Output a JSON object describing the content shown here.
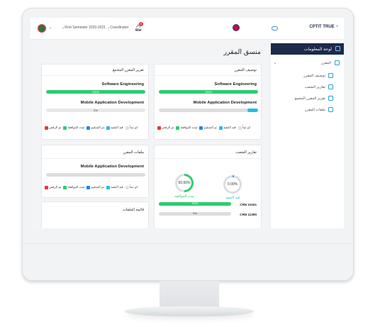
{
  "topbar": {
    "semester": "First Semester 2020-2021",
    "role": "Coordinator",
    "notifications": "0",
    "brand": "CPTIT TRUE"
  },
  "sidebar": {
    "dashboard": "لوحة المعلومات",
    "course": "المقرر",
    "items": [
      "توصيف المقرر",
      "تقارير الشعب",
      "تقرير المقرر المجمع",
      "ملفات المقرر"
    ]
  },
  "main": {
    "title": "منسق المقرر",
    "course_spec": {
      "header": "توصيف المقرر",
      "courses": [
        {
          "name": "Software Engineering",
          "percent": "100%",
          "progress": 100,
          "color": "#2ecc71"
        },
        {
          "name": "Mobile Application Development",
          "percent": "",
          "progress": 11,
          "color": "#1bbfe6"
        }
      ]
    },
    "combined_report": {
      "header": "تقرير المقرر المجمع",
      "courses": [
        {
          "name": "Software Engineering",
          "percent": "100%",
          "progress": 100,
          "color": "#2ecc71"
        },
        {
          "name": "Mobile Application Development",
          "percent": "0%",
          "progress": 0,
          "color": "#2ecc71"
        }
      ]
    },
    "legend": [
      {
        "label": "لم تبدأ",
        "color": "#e0e0e0"
      },
      {
        "label": "قيد التنفيذ",
        "color": "#29b6f6"
      },
      {
        "label": "تم التسليم",
        "color": "#1e88e5"
      },
      {
        "label": "تمت الموافقة",
        "color": "#2ecc71"
      },
      {
        "label": "تم الرفض",
        "color": "#e53935"
      }
    ],
    "course_files": {
      "header": "ملفات المقرر",
      "course": "Mobile Application Development"
    },
    "sections_report": {
      "header": "تقارير الشعب",
      "ring_in_progress": {
        "value": "0.00%",
        "label": "قيد التنفيذ",
        "progress": 0
      },
      "ring_approved": {
        "value": "50.00%",
        "label": "تمت الموافقة",
        "progress": 50
      },
      "crns": [
        {
          "name": "CRN 11041",
          "percent": "100%",
          "progress": 100
        },
        {
          "name": "CRN 11390",
          "percent": "0%",
          "progress": 0
        }
      ]
    },
    "files_list": {
      "header": "قائمة الملفات"
    }
  }
}
